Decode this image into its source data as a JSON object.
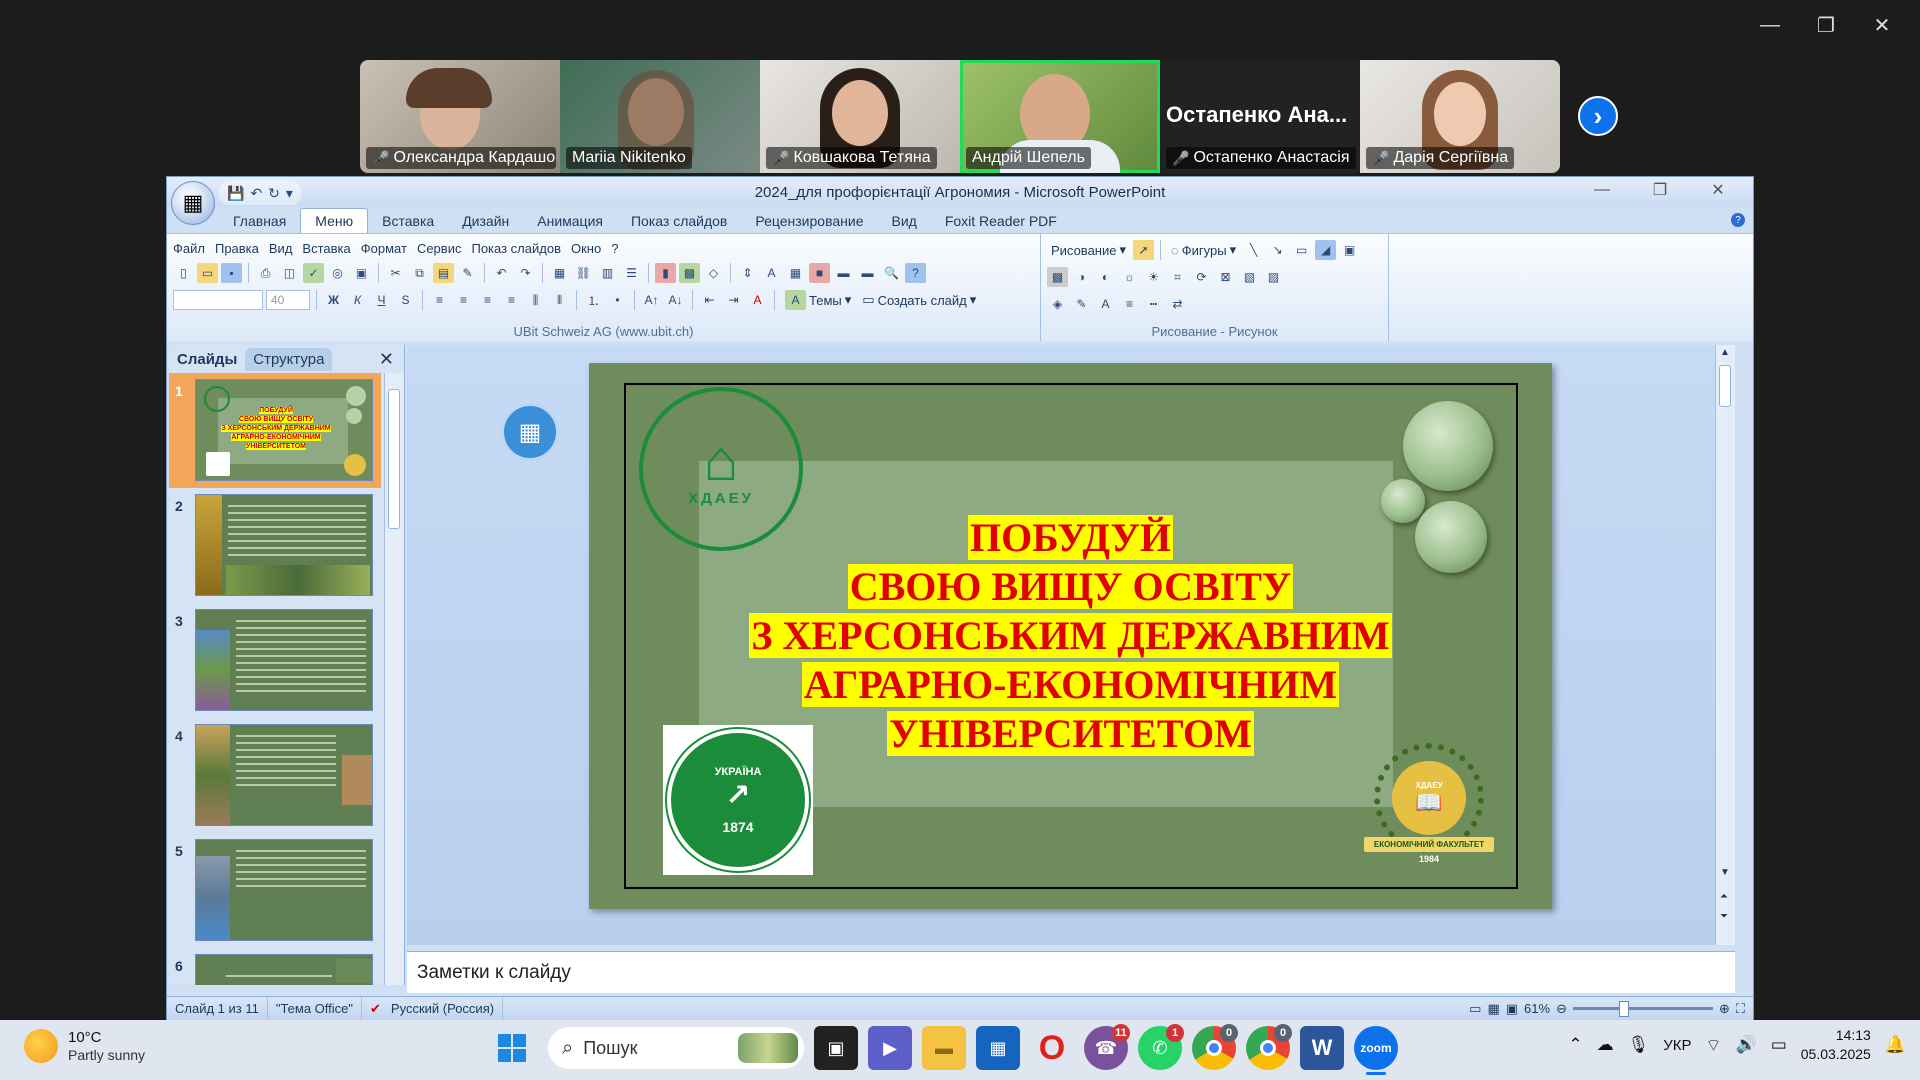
{
  "participants": [
    {
      "name": "Олександра Кардашо...",
      "muted": true
    },
    {
      "name": "Mariia Nikitenko",
      "muted": false
    },
    {
      "name": "Ковшакова Тетяна",
      "muted": true
    },
    {
      "name": "Андрій Шепель",
      "muted": false,
      "active": true
    },
    {
      "name": "Остапенко Анастасія",
      "muted": true,
      "big_name": "Остапенко Ана..."
    },
    {
      "name": "Дарія Сергіївна",
      "muted": true
    }
  ],
  "ppt": {
    "title": "2024_для профорієнтації Агрономия - Microsoft PowerPoint",
    "tabs": [
      "Главная",
      "Меню",
      "Вставка",
      "Дизайн",
      "Анимация",
      "Показ слайдов",
      "Рецензирование",
      "Вид",
      "Foxit Reader PDF"
    ],
    "menu": [
      "Файл",
      "Правка",
      "Вид",
      "Вставка",
      "Формат",
      "Сервис",
      "Показ слайдов",
      "Окно",
      "?"
    ],
    "font_size": "40",
    "themes_label": "Темы",
    "create_slide_label": "Создать слайд",
    "group_ubit": "UBit Schweiz AG    (www.ubit.ch)",
    "draw_label": "Рисование",
    "shapes_label": "Фигуры",
    "group_draw": "Рисование - Рисунок",
    "pane_tabs": {
      "slides": "Слайды",
      "outline": "Структура"
    },
    "slide_numbers": [
      "1",
      "2",
      "3",
      "4",
      "5",
      "6"
    ],
    "slide": {
      "lines": [
        "ПОБУДУЙ",
        "СВОЮ  ВИЩУ ОСВІТУ",
        "З ХЕРСОНСЬКИМ ДЕРЖАВНИМ",
        "АГРАРНО-ЕКОНОМІЧНИМ",
        "УНІВЕРСИТЕТОМ"
      ],
      "logo_text": "ХДАЕУ",
      "logo2_top": "УКРАЇНА",
      "logo2_year": "1874",
      "logo3_text": "ХДАЕУ",
      "logo3_ribbon": "ЕКОНОМІЧНИЙ ФАКУЛЬТЕТ",
      "logo3_year": "1984"
    },
    "notes_placeholder": "Заметки к слайду",
    "status": {
      "slide": "Слайд 1 из 11",
      "theme": "\"Тема Office\"",
      "lang": "Русский (Россия)",
      "zoom": "61%"
    }
  },
  "taskbar": {
    "temp": "10°C",
    "weather": "Partly sunny",
    "search": "Пошук",
    "badges": {
      "viber": "11",
      "whatsapp": "1",
      "chrome1": "0",
      "chrome2": "0"
    },
    "lang": "УКР",
    "time": "14:13",
    "date": "05.03.2025"
  }
}
